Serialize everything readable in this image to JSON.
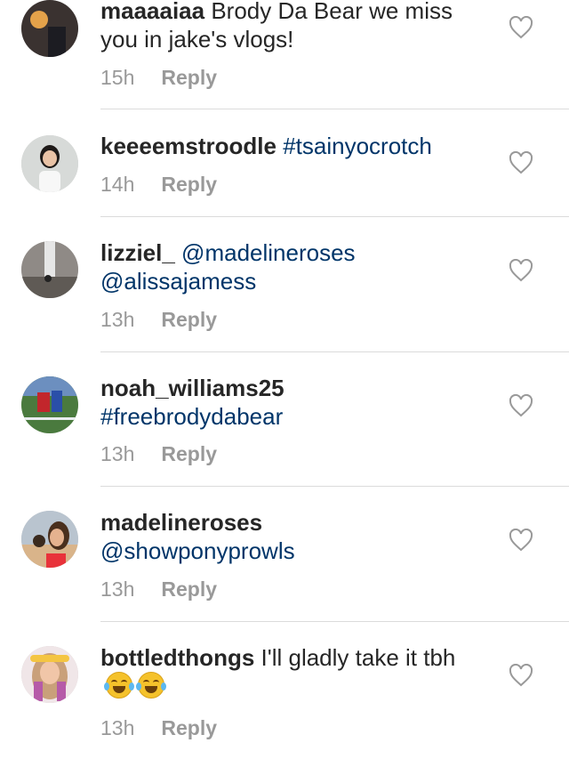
{
  "comments": [
    {
      "username": "maaaaiaa",
      "text": " Brody Da Bear we miss you in jake's vlogs!",
      "time": "15h",
      "reply": "Reply"
    },
    {
      "username": "keeeemstroodle",
      "text": "",
      "mention": " #tsainyocrotch",
      "time": "14h",
      "reply": "Reply"
    },
    {
      "username": "lizziel_",
      "mention": " @madelineroses",
      "mention2": "@alissajamess",
      "time": "13h",
      "reply": "Reply"
    },
    {
      "username": "noah_williams25",
      "mention": "#freebrodydabear",
      "time": "13h",
      "reply": "Reply"
    },
    {
      "username": "madelineroses",
      "mention": "@showponyprowls",
      "time": "13h",
      "reply": "Reply"
    },
    {
      "username": "bottledthongs",
      "text": " I'll gladly take it tbh",
      "emoji": [
        "face-with-tears-of-joy",
        "face-with-tears-of-joy"
      ],
      "time": "13h",
      "reply": "Reply"
    }
  ],
  "colors": {
    "username": "#262626",
    "link": "#003569",
    "meta": "#999999",
    "divider": "#dbdbdb"
  },
  "icons": {
    "like": "heart-outline-icon"
  }
}
